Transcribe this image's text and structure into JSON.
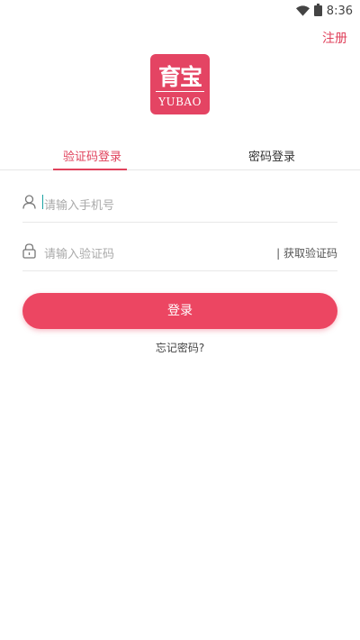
{
  "status_bar": {
    "time": "8:36",
    "icons": [
      "wifi-icon",
      "battery-icon"
    ]
  },
  "header": {
    "register_label": "注册"
  },
  "logo": {
    "chinese": "育宝",
    "english": "YUBAO"
  },
  "tabs": [
    {
      "label": "验证码登录",
      "active": true
    },
    {
      "label": "密码登录",
      "active": false
    }
  ],
  "form": {
    "phone": {
      "icon": "user-icon",
      "placeholder": "请输入手机号",
      "value": ""
    },
    "code": {
      "icon": "lock-icon",
      "placeholder": "请输入验证码",
      "value": "",
      "get_code_label": "| 获取验证码"
    }
  },
  "login_button": {
    "label": "登录"
  },
  "forgot_password": {
    "label": "忘记密码?"
  },
  "colors": {
    "accent": "#e0425c",
    "button": "#ec4662",
    "cursor": "#1aa2a2"
  }
}
